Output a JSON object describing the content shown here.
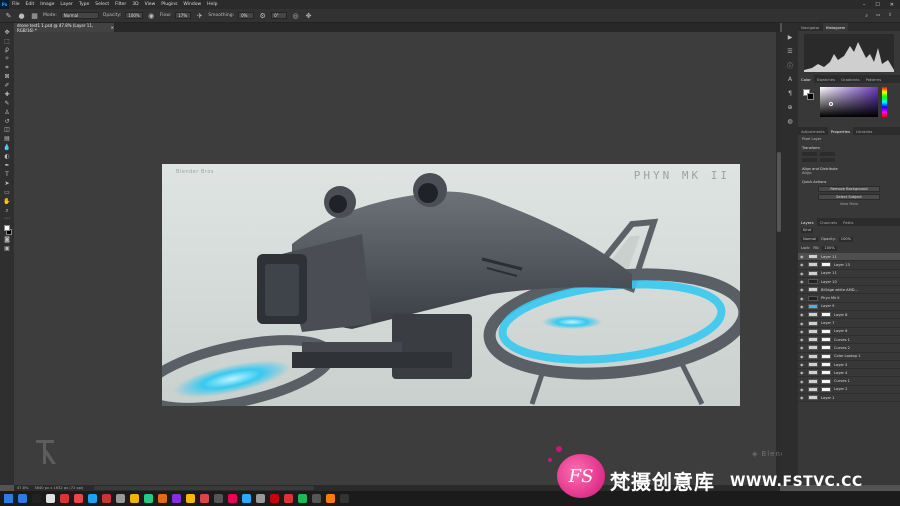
{
  "menubar": {
    "app": "Ps",
    "items": [
      "File",
      "Edit",
      "Image",
      "Layer",
      "Type",
      "Select",
      "Filter",
      "3D",
      "View",
      "Plugins",
      "Window",
      "Help"
    ]
  },
  "options": {
    "mode_label": "Mode:",
    "mode_value": "Normal",
    "opacity_label": "Opacity:",
    "opacity_value": "100%",
    "flow_label": "Flow:",
    "flow_value": "17%",
    "smoothing_label": "Smoothing:",
    "smoothing_value": "0%",
    "angle_value": "0°"
  },
  "document": {
    "tab_title": "drone test1 1.psd @ 47.8% (Layer 11, RGB/16) *",
    "art_brand": "Blender Bros",
    "art_title": "PHYN MK II"
  },
  "status": {
    "zoom": "47.8%",
    "doc_info": "3840 px x 1632 px (72 ppi)"
  },
  "panels": {
    "top_tabs": [
      "Navigator",
      "Histogram"
    ],
    "color_tabs": [
      "Color",
      "Swatches",
      "Gradients",
      "Patterns"
    ],
    "prop_tabs": [
      "Adjustments",
      "Properties",
      "Libraries"
    ],
    "pixel_layer": "Pixel Layer",
    "transform": "Transform",
    "align": "Align and Distribute",
    "align_sub": "Align:",
    "quick_actions": "Quick Actions",
    "remove_bg": "Remove Background",
    "select_subject": "Select Subject",
    "view_more": "View More",
    "layer_tabs": [
      "Layers",
      "Channels",
      "Paths"
    ],
    "kind": "Kind",
    "blend": "Normal",
    "opacity_label": "Opacity:",
    "opacity": "100%",
    "lock_label": "Lock:",
    "fill_label": "Fill:",
    "fill": "100%"
  },
  "layers": [
    {
      "name": "Layer 11",
      "selected": true,
      "thumb": "light",
      "mask": false
    },
    {
      "name": "Layer 13",
      "selected": false,
      "thumb": "light",
      "mask": true
    },
    {
      "name": "Layer 11",
      "selected": false,
      "thumb": "light",
      "mask": false
    },
    {
      "name": "Layer 10",
      "selected": false,
      "thumb": "dark",
      "mask": false
    },
    {
      "name": "BlOdge white AMD...",
      "selected": false,
      "thumb": "light",
      "mask": false
    },
    {
      "name": "Phyn Mk II",
      "selected": false,
      "thumb": "dark",
      "mask": false
    },
    {
      "name": "Layer 9",
      "selected": false,
      "thumb": "blue",
      "mask": false
    },
    {
      "name": "Layer 8",
      "selected": false,
      "thumb": "light",
      "mask": true
    },
    {
      "name": "Layer 7",
      "selected": false,
      "thumb": "light",
      "mask": false
    },
    {
      "name": "Layer 6",
      "selected": false,
      "thumb": "light",
      "mask": true
    },
    {
      "name": "Curves 1",
      "selected": false,
      "thumb": "light",
      "mask": true
    },
    {
      "name": "Curves 2",
      "selected": false,
      "thumb": "light",
      "mask": true
    },
    {
      "name": "Color Lookup 1",
      "selected": false,
      "thumb": "light",
      "mask": true
    },
    {
      "name": "Layer 5",
      "selected": false,
      "thumb": "light",
      "mask": true
    },
    {
      "name": "Layer 4",
      "selected": false,
      "thumb": "light",
      "mask": true
    },
    {
      "name": "Curves 1",
      "selected": false,
      "thumb": "light",
      "mask": true
    },
    {
      "name": "Layer 2",
      "selected": false,
      "thumb": "light",
      "mask": true
    },
    {
      "name": "Layer 1",
      "selected": false,
      "thumb": "light",
      "mask": false
    }
  ],
  "watermark": {
    "logo_text": "FS",
    "chinese": "梵摄创意库",
    "url": "WWW.FSTVC.CC"
  },
  "bottom_brand": "Blender Bros",
  "colors": {
    "accent_glow": "#36c9f0",
    "watermark_pink": "#d0157a",
    "ps_blue": "#31a8ff"
  }
}
